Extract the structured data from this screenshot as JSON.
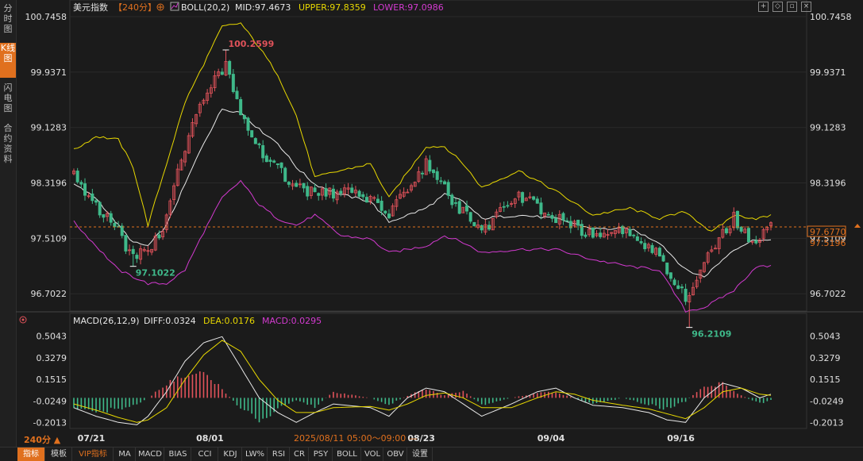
{
  "sidebar": {
    "tabs": [
      {
        "label": "分时图"
      },
      {
        "label": "K线图"
      },
      {
        "label": "闪电图"
      },
      {
        "label": "合约资料"
      }
    ]
  },
  "main_header": {
    "instrument": "美元指数",
    "period": "【240分】",
    "boll_label": "BOLL(20,2)",
    "mid": "MID:97.4673",
    "upper": "UPPER:97.8359",
    "lower": "LOWER:97.0986"
  },
  "macd_header": {
    "label": "MACD(26,12,9)",
    "diff": "DIFF:0.0324",
    "dea": "DEA:0.0176",
    "macd": "MACD:0.0295"
  },
  "period_selector": "240分 ▲",
  "time_range": "2025/08/11 05:00～09:00 —",
  "price_tag_last": "97.6770",
  "price_tag_mid": "97.5196",
  "annotations": {
    "high": "100.2599",
    "low_left": "97.1022",
    "low_right": "96.2109"
  },
  "bottom_tabs": [
    {
      "label": "指标",
      "active": true
    },
    {
      "label": "模板"
    },
    {
      "label": "VIP指标",
      "vip": true
    },
    {
      "label": "MA"
    },
    {
      "label": "MACD"
    },
    {
      "label": "BIAS"
    },
    {
      "label": "CCI"
    },
    {
      "label": "KDJ"
    },
    {
      "label": "LW%"
    },
    {
      "label": "RSI"
    },
    {
      "label": "CR"
    },
    {
      "label": "PSY"
    },
    {
      "label": "BOLL"
    },
    {
      "label": "VOL"
    },
    {
      "label": "OBV"
    },
    {
      "label": "设置"
    }
  ],
  "colors": {
    "up": "#e0525a",
    "down": "#3fb98a",
    "upper": "#e8d800",
    "mid": "#e8e8e8",
    "lower": "#d33ad0",
    "dea": "#e8d800",
    "diff": "#e8e8e8",
    "accent": "#e0701e",
    "dashed": "#e0701e"
  },
  "chart_data": [
    {
      "type": "candlestick",
      "title": "美元指数【240分】",
      "y_ticks": [
        "100.7458",
        "99.9371",
        "99.1283",
        "98.3196",
        "97.5109",
        "96.7022"
      ],
      "ylim": [
        96.45,
        100.7458
      ],
      "x_tick_labels": [
        "07/21",
        "08/01",
        "08/23",
        "09/04",
        "09/16"
      ],
      "x_tick_index": [
        1,
        33,
        90,
        125,
        160
      ],
      "series": [
        {
          "name": "Candles",
          "keypoints": [
            [
              0,
              98.45
            ],
            [
              6,
              98.0
            ],
            [
              12,
              97.6
            ],
            [
              16,
              97.2
            ],
            [
              23,
              97.5
            ],
            [
              28,
              98.5
            ],
            [
              33,
              99.3
            ],
            [
              38,
              99.8
            ],
            [
              41,
              100.05
            ],
            [
              45,
              99.4
            ],
            [
              50,
              98.8
            ],
            [
              57,
              98.4
            ],
            [
              65,
              98.15
            ],
            [
              75,
              98.2
            ],
            [
              85,
              97.9
            ],
            [
              95,
              98.6
            ],
            [
              103,
              98.0
            ],
            [
              110,
              97.6
            ],
            [
              120,
              98.15
            ],
            [
              130,
              97.8
            ],
            [
              140,
              97.55
            ],
            [
              150,
              97.6
            ],
            [
              158,
              97.25
            ],
            [
              165,
              96.65
            ],
            [
              172,
              97.35
            ],
            [
              178,
              97.8
            ],
            [
              183,
              97.45
            ],
            [
              188,
              97.68
            ]
          ]
        },
        {
          "name": "UPPER",
          "keypoints": [
            [
              0,
              98.8
            ],
            [
              6,
              99.0
            ],
            [
              12,
              98.95
            ],
            [
              16,
              98.55
            ],
            [
              20,
              97.7
            ],
            [
              25,
              98.6
            ],
            [
              30,
              99.5
            ],
            [
              35,
              100.05
            ],
            [
              40,
              100.6
            ],
            [
              45,
              100.65
            ],
            [
              50,
              100.3
            ],
            [
              55,
              99.9
            ],
            [
              60,
              99.3
            ],
            [
              65,
              98.4
            ],
            [
              72,
              98.5
            ],
            [
              80,
              98.6
            ],
            [
              85,
              98.1
            ],
            [
              95,
              98.85
            ],
            [
              100,
              98.85
            ],
            [
              105,
              98.6
            ],
            [
              110,
              98.25
            ],
            [
              120,
              98.5
            ],
            [
              130,
              98.2
            ],
            [
              140,
              97.85
            ],
            [
              150,
              97.95
            ],
            [
              158,
              97.8
            ],
            [
              165,
              97.9
            ],
            [
              172,
              97.6
            ],
            [
              178,
              97.85
            ],
            [
              184,
              97.8
            ],
            [
              188,
              97.84
            ]
          ]
        },
        {
          "name": "MID",
          "keypoints": [
            [
              0,
              98.3
            ],
            [
              6,
              98.1
            ],
            [
              12,
              97.7
            ],
            [
              16,
              97.45
            ],
            [
              20,
              97.4
            ],
            [
              25,
              97.7
            ],
            [
              30,
              98.3
            ],
            [
              35,
              98.9
            ],
            [
              40,
              99.4
            ],
            [
              45,
              99.35
            ],
            [
              50,
              99.1
            ],
            [
              55,
              98.9
            ],
            [
              60,
              98.55
            ],
            [
              65,
              98.3
            ],
            [
              72,
              98.15
            ],
            [
              80,
              98.05
            ],
            [
              85,
              97.75
            ],
            [
              95,
              97.95
            ],
            [
              100,
              98.15
            ],
            [
              105,
              98.05
            ],
            [
              110,
              97.8
            ],
            [
              120,
              97.85
            ],
            [
              130,
              97.8
            ],
            [
              140,
              97.65
            ],
            [
              150,
              97.65
            ],
            [
              158,
              97.45
            ],
            [
              165,
              97.05
            ],
            [
              170,
              96.95
            ],
            [
              178,
              97.35
            ],
            [
              184,
              97.5
            ],
            [
              188,
              97.47
            ]
          ]
        },
        {
          "name": "LOWER",
          "keypoints": [
            [
              0,
              97.75
            ],
            [
              6,
              97.4
            ],
            [
              12,
              97.05
            ],
            [
              16,
              96.95
            ],
            [
              20,
              96.85
            ],
            [
              25,
              96.85
            ],
            [
              30,
              97.05
            ],
            [
              35,
              97.6
            ],
            [
              40,
              98.1
            ],
            [
              45,
              98.35
            ],
            [
              50,
              98.0
            ],
            [
              55,
              97.8
            ],
            [
              60,
              97.7
            ],
            [
              65,
              97.85
            ],
            [
              72,
              97.55
            ],
            [
              80,
              97.5
            ],
            [
              85,
              97.3
            ],
            [
              95,
              97.4
            ],
            [
              100,
              97.55
            ],
            [
              105,
              97.45
            ],
            [
              110,
              97.3
            ],
            [
              120,
              97.35
            ],
            [
              130,
              97.35
            ],
            [
              140,
              97.2
            ],
            [
              150,
              97.1
            ],
            [
              158,
              97.05
            ],
            [
              165,
              96.45
            ],
            [
              170,
              96.5
            ],
            [
              178,
              96.75
            ],
            [
              184,
              97.1
            ],
            [
              188,
              97.1
            ]
          ]
        }
      ],
      "markers": [
        {
          "label": "100.2599",
          "index": 41,
          "value": 100.2599
        },
        {
          "label": "97.1022",
          "index": 16,
          "value": 97.1022
        },
        {
          "label": "96.2109",
          "index": 166,
          "value": 96.2109
        }
      ],
      "current_price": 97.677
    },
    {
      "type": "bar+line",
      "title": "MACD(26,12,9)",
      "y_ticks": [
        "0.5043",
        "0.3279",
        "0.1515",
        "-0.0249",
        "-0.2013"
      ],
      "ylim": [
        -0.25,
        0.56
      ],
      "series": [
        {
          "name": "MACD",
          "keypoints": [
            [
              0,
              -0.08
            ],
            [
              6,
              -0.12
            ],
            [
              12,
              -0.1
            ],
            [
              17,
              -0.06
            ],
            [
              20,
              0.0
            ],
            [
              25,
              0.12
            ],
            [
              30,
              0.2
            ],
            [
              35,
              0.24
            ],
            [
              40,
              0.08
            ],
            [
              45,
              -0.1
            ],
            [
              50,
              -0.2
            ],
            [
              55,
              -0.1
            ],
            [
              60,
              -0.02
            ],
            [
              65,
              -0.08
            ],
            [
              70,
              0.05
            ],
            [
              80,
              0.0
            ],
            [
              85,
              -0.06
            ],
            [
              90,
              0.02
            ],
            [
              95,
              0.08
            ],
            [
              100,
              0.02
            ],
            [
              105,
              0.06
            ],
            [
              110,
              -0.06
            ],
            [
              118,
              0.0
            ],
            [
              125,
              0.04
            ],
            [
              130,
              0.05
            ],
            [
              135,
              0.0
            ],
            [
              140,
              -0.06
            ],
            [
              148,
              0.0
            ],
            [
              155,
              -0.06
            ],
            [
              160,
              -0.1
            ],
            [
              165,
              -0.03
            ],
            [
              170,
              0.1
            ],
            [
              175,
              0.12
            ],
            [
              180,
              0.02
            ],
            [
              185,
              -0.05
            ],
            [
              188,
              -0.02
            ]
          ]
        },
        {
          "name": "DIFF",
          "keypoints": [
            [
              0,
              -0.08
            ],
            [
              6,
              -0.15
            ],
            [
              12,
              -0.2
            ],
            [
              17,
              -0.22
            ],
            [
              20,
              -0.15
            ],
            [
              25,
              0.05
            ],
            [
              30,
              0.3
            ],
            [
              35,
              0.45
            ],
            [
              40,
              0.5
            ],
            [
              45,
              0.25
            ],
            [
              50,
              0.0
            ],
            [
              55,
              -0.12
            ],
            [
              60,
              -0.2
            ],
            [
              65,
              -0.12
            ],
            [
              70,
              -0.05
            ],
            [
              80,
              -0.08
            ],
            [
              85,
              -0.15
            ],
            [
              90,
              0.0
            ],
            [
              95,
              0.08
            ],
            [
              100,
              0.05
            ],
            [
              105,
              -0.05
            ],
            [
              110,
              -0.15
            ],
            [
              118,
              -0.05
            ],
            [
              125,
              0.05
            ],
            [
              130,
              0.08
            ],
            [
              135,
              0.0
            ],
            [
              140,
              -0.06
            ],
            [
              148,
              -0.08
            ],
            [
              155,
              -0.12
            ],
            [
              160,
              -0.18
            ],
            [
              165,
              -0.2
            ],
            [
              170,
              0.0
            ],
            [
              175,
              0.12
            ],
            [
              180,
              0.08
            ],
            [
              185,
              0.0
            ],
            [
              188,
              0.03
            ]
          ]
        },
        {
          "name": "DEA",
          "keypoints": [
            [
              0,
              -0.05
            ],
            [
              6,
              -0.1
            ],
            [
              12,
              -0.16
            ],
            [
              17,
              -0.2
            ],
            [
              20,
              -0.18
            ],
            [
              25,
              -0.08
            ],
            [
              30,
              0.15
            ],
            [
              35,
              0.35
            ],
            [
              40,
              0.47
            ],
            [
              45,
              0.38
            ],
            [
              50,
              0.15
            ],
            [
              55,
              -0.02
            ],
            [
              60,
              -0.12
            ],
            [
              65,
              -0.12
            ],
            [
              70,
              -0.08
            ],
            [
              80,
              -0.07
            ],
            [
              85,
              -0.1
            ],
            [
              90,
              -0.05
            ],
            [
              95,
              0.02
            ],
            [
              100,
              0.04
            ],
            [
              105,
              0.0
            ],
            [
              110,
              -0.08
            ],
            [
              118,
              -0.08
            ],
            [
              125,
              0.0
            ],
            [
              130,
              0.05
            ],
            [
              135,
              0.03
            ],
            [
              140,
              -0.02
            ],
            [
              148,
              -0.06
            ],
            [
              155,
              -0.09
            ],
            [
              160,
              -0.13
            ],
            [
              165,
              -0.17
            ],
            [
              170,
              -0.08
            ],
            [
              175,
              0.05
            ],
            [
              180,
              0.08
            ],
            [
              185,
              0.03
            ],
            [
              188,
              0.02
            ]
          ]
        }
      ]
    }
  ]
}
